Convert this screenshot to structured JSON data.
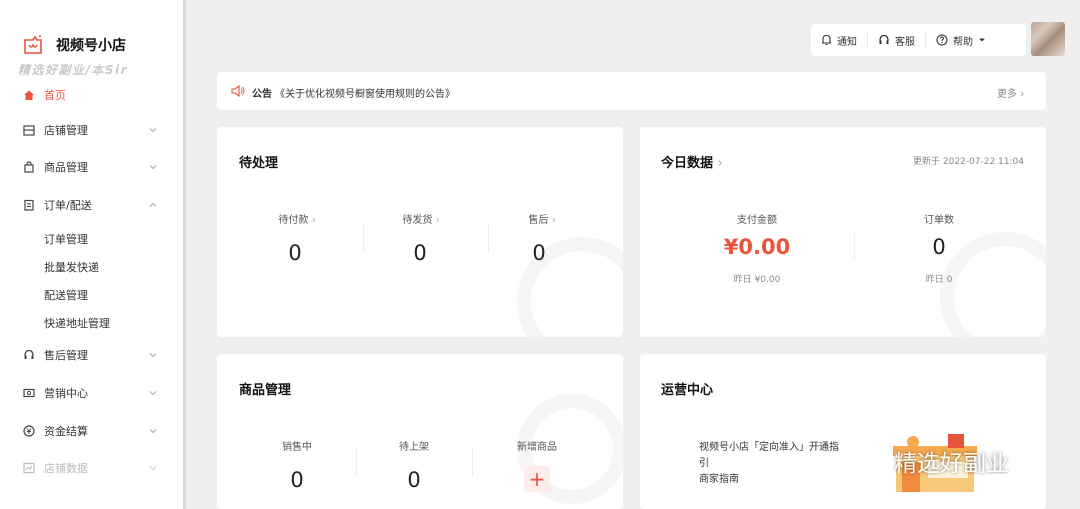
{
  "sidebar": {
    "brand": "视频号小店",
    "watermark": "精选好副业/本Sir",
    "items": [
      {
        "label": "首页",
        "icon": "home-icon"
      },
      {
        "label": "店铺管理",
        "icon": "store-icon"
      },
      {
        "label": "商品管理",
        "icon": "bag-icon"
      },
      {
        "label": "订单/配送",
        "icon": "order-icon"
      },
      {
        "label": "售后管理",
        "icon": "headset-icon"
      },
      {
        "label": "营销中心",
        "icon": "coupon-icon"
      },
      {
        "label": "资金结算",
        "icon": "money-icon"
      },
      {
        "label": "店铺数据",
        "icon": "chart-icon"
      }
    ],
    "order_subitems": [
      "订单管理",
      "批量发快递",
      "配送管理",
      "快递地址管理"
    ]
  },
  "topbar": {
    "notify": "通知",
    "service": "客服",
    "help": "帮助"
  },
  "notice": {
    "tag": "公告",
    "text": "《关于优化视频号橱窗使用规则的公告》",
    "more": "更多"
  },
  "pending": {
    "title": "待处理",
    "stats": [
      {
        "label": "待付款",
        "value": "0"
      },
      {
        "label": "待发货",
        "value": "0"
      },
      {
        "label": "售后",
        "value": "0"
      }
    ]
  },
  "today": {
    "title": "今日数据",
    "updated": "更新于 2022-07-22 11:04",
    "pay_label": "支付金额",
    "pay_value": "¥0.00",
    "pay_yesterday": "昨日 ¥0.00",
    "order_label": "订单数",
    "order_value": "0",
    "order_yesterday": "昨日 0"
  },
  "products": {
    "title": "商品管理",
    "stats": [
      {
        "label": "销售中",
        "value": "0"
      },
      {
        "label": "待上架",
        "value": "0"
      },
      {
        "label": "新增商品",
        "value": "+"
      }
    ]
  },
  "ops": {
    "title": "运营中心",
    "line1": "视频号小店「定向准入」开通指",
    "line2": "引",
    "line3": "商家指南"
  },
  "overlay_watermark": "精选好副业",
  "colors": {
    "accent": "#e8553a",
    "bg": "#efefef"
  }
}
